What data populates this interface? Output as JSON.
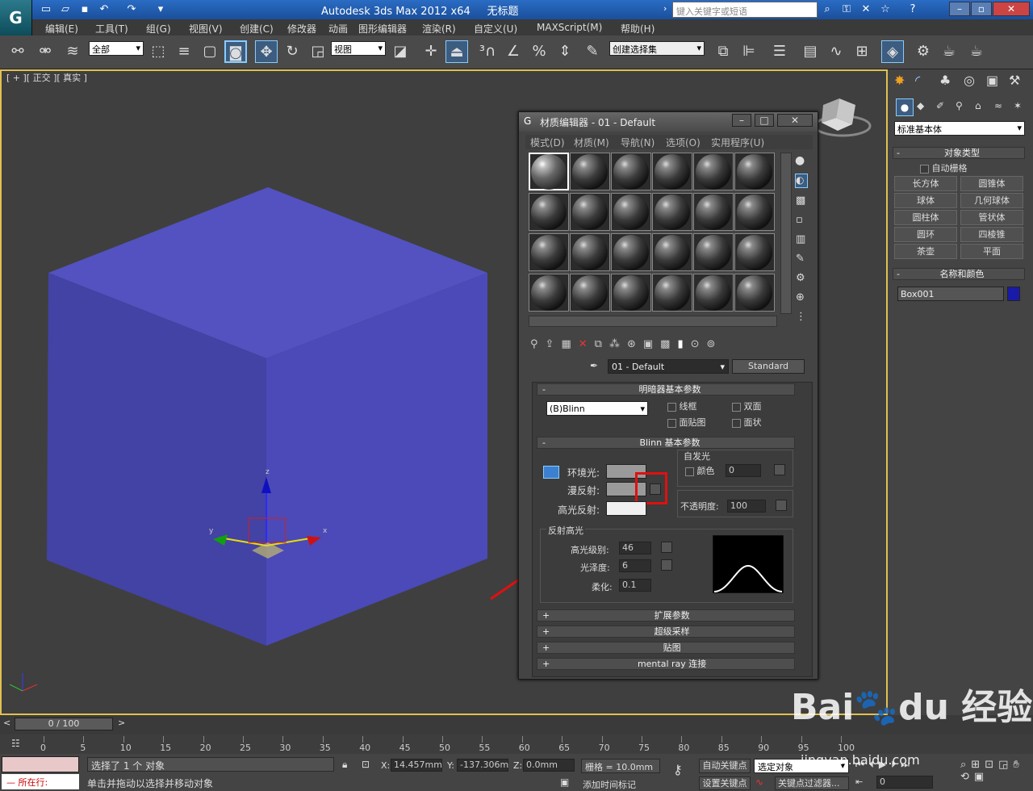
{
  "app": {
    "title": "Autodesk 3ds Max  2012 x64",
    "doc": "无标题",
    "search_placeholder": "键入关键字或短语"
  },
  "menu": [
    "编辑(E)",
    "工具(T)",
    "组(G)",
    "视图(V)",
    "创建(C)",
    "修改器",
    "动画",
    "图形编辑器",
    "渲染(R)",
    "自定义(U)",
    "MAXScript(M)",
    "帮助(H)"
  ],
  "toolbar": {
    "filter": "全部",
    "refcoord": "视图",
    "selset": "创建选择集"
  },
  "viewport": {
    "label": "[ + ][ 正交 ][ 真实 ]",
    "cube_color": "#4a46b2"
  },
  "right_panel": {
    "category": "标准基本体",
    "object_type_title": "对象类型",
    "autogrid": "自动栅格",
    "buttons": [
      "长方体",
      "圆锥体",
      "球体",
      "几何球体",
      "圆柱体",
      "管状体",
      "圆环",
      "四棱锥",
      "茶壶",
      "平面"
    ],
    "name_color_title": "名称和颜色",
    "object_name": "Box001",
    "object_color": "#1a1aa8"
  },
  "material_editor": {
    "title": "材质编辑器 - 01 - Default",
    "menu": [
      "模式(D)",
      "材质(M)",
      "导航(N)",
      "选项(O)",
      "实用程序(U)"
    ],
    "material_name": "01 - Default",
    "material_type": "Standard",
    "shader_rollout": "明暗器基本参数",
    "shader": "(B)Blinn",
    "shader_opts": [
      "线框",
      "双面",
      "面贴图",
      "面状"
    ],
    "blinn_rollout": "Blinn 基本参数",
    "self_illum": "自发光",
    "color_label": "颜色",
    "self_illum_value": "0",
    "ambient": "环境光:",
    "diffuse": "漫反射:",
    "specular": "高光反射:",
    "opacity_label": "不透明度:",
    "opacity": "100",
    "spec_hl": "反射高光",
    "spec_level_label": "高光级别:",
    "spec_level": "46",
    "gloss_label": "光泽度:",
    "gloss": "6",
    "soften_label": "柔化:",
    "soften": "0.1",
    "rollouts": [
      "扩展参数",
      "超级采样",
      "贴图",
      "mental ray 连接"
    ]
  },
  "timeline": {
    "frame": "0 / 100",
    "ticks": [
      "0",
      "5",
      "10",
      "15",
      "20",
      "25",
      "30",
      "35",
      "40",
      "45",
      "50",
      "55",
      "60",
      "65",
      "70",
      "75",
      "80",
      "85",
      "90",
      "95",
      "100"
    ]
  },
  "status": {
    "running": "所在行:",
    "selected": "选择了 1 个 对象",
    "hint": "单击并拖动以选择并移动对象",
    "x_label": "X:",
    "x": "14.457mm",
    "y_label": "Y:",
    "y": "-137.306m",
    "z_label": "Z:",
    "z": "0.0mm",
    "grid": "栅格 = 10.0mm",
    "auto_key": "自动关键点",
    "set_key": "设置关键点",
    "sel_obj": "选定对象",
    "key_filter": "关键点过滤器...",
    "add_tag": "添加时间标记",
    "frame_field": "0"
  },
  "watermark": "jingyan.baidu.com"
}
